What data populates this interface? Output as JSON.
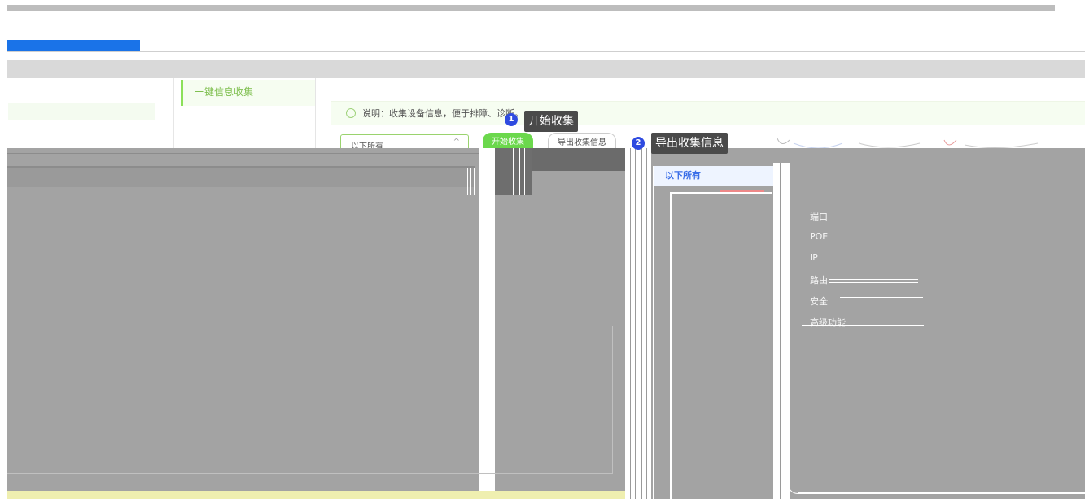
{
  "left_menu": {
    "item": "一键信息收集"
  },
  "notice": {
    "text": "说明：收集设备信息，便于排障、诊断。"
  },
  "controls": {
    "select_value": "以下所有",
    "start_button": "开始收集",
    "export_button": "导出收集信息"
  },
  "guide": {
    "step1_number": "1",
    "step1_label": "开始收集",
    "step2_number": "2",
    "step2_label": "导出收集信息"
  },
  "dropdown": {
    "selected": "以下所有"
  },
  "submenu": {
    "items": [
      "端口",
      "POE",
      "IP",
      "路由",
      "安全",
      "高级功能"
    ]
  },
  "colors": {
    "accent_green": "#6bd84c",
    "tab_blue": "#1a73e8",
    "badge_blue": "#2f4be0",
    "overlay_gray": "#a3a3a3"
  }
}
